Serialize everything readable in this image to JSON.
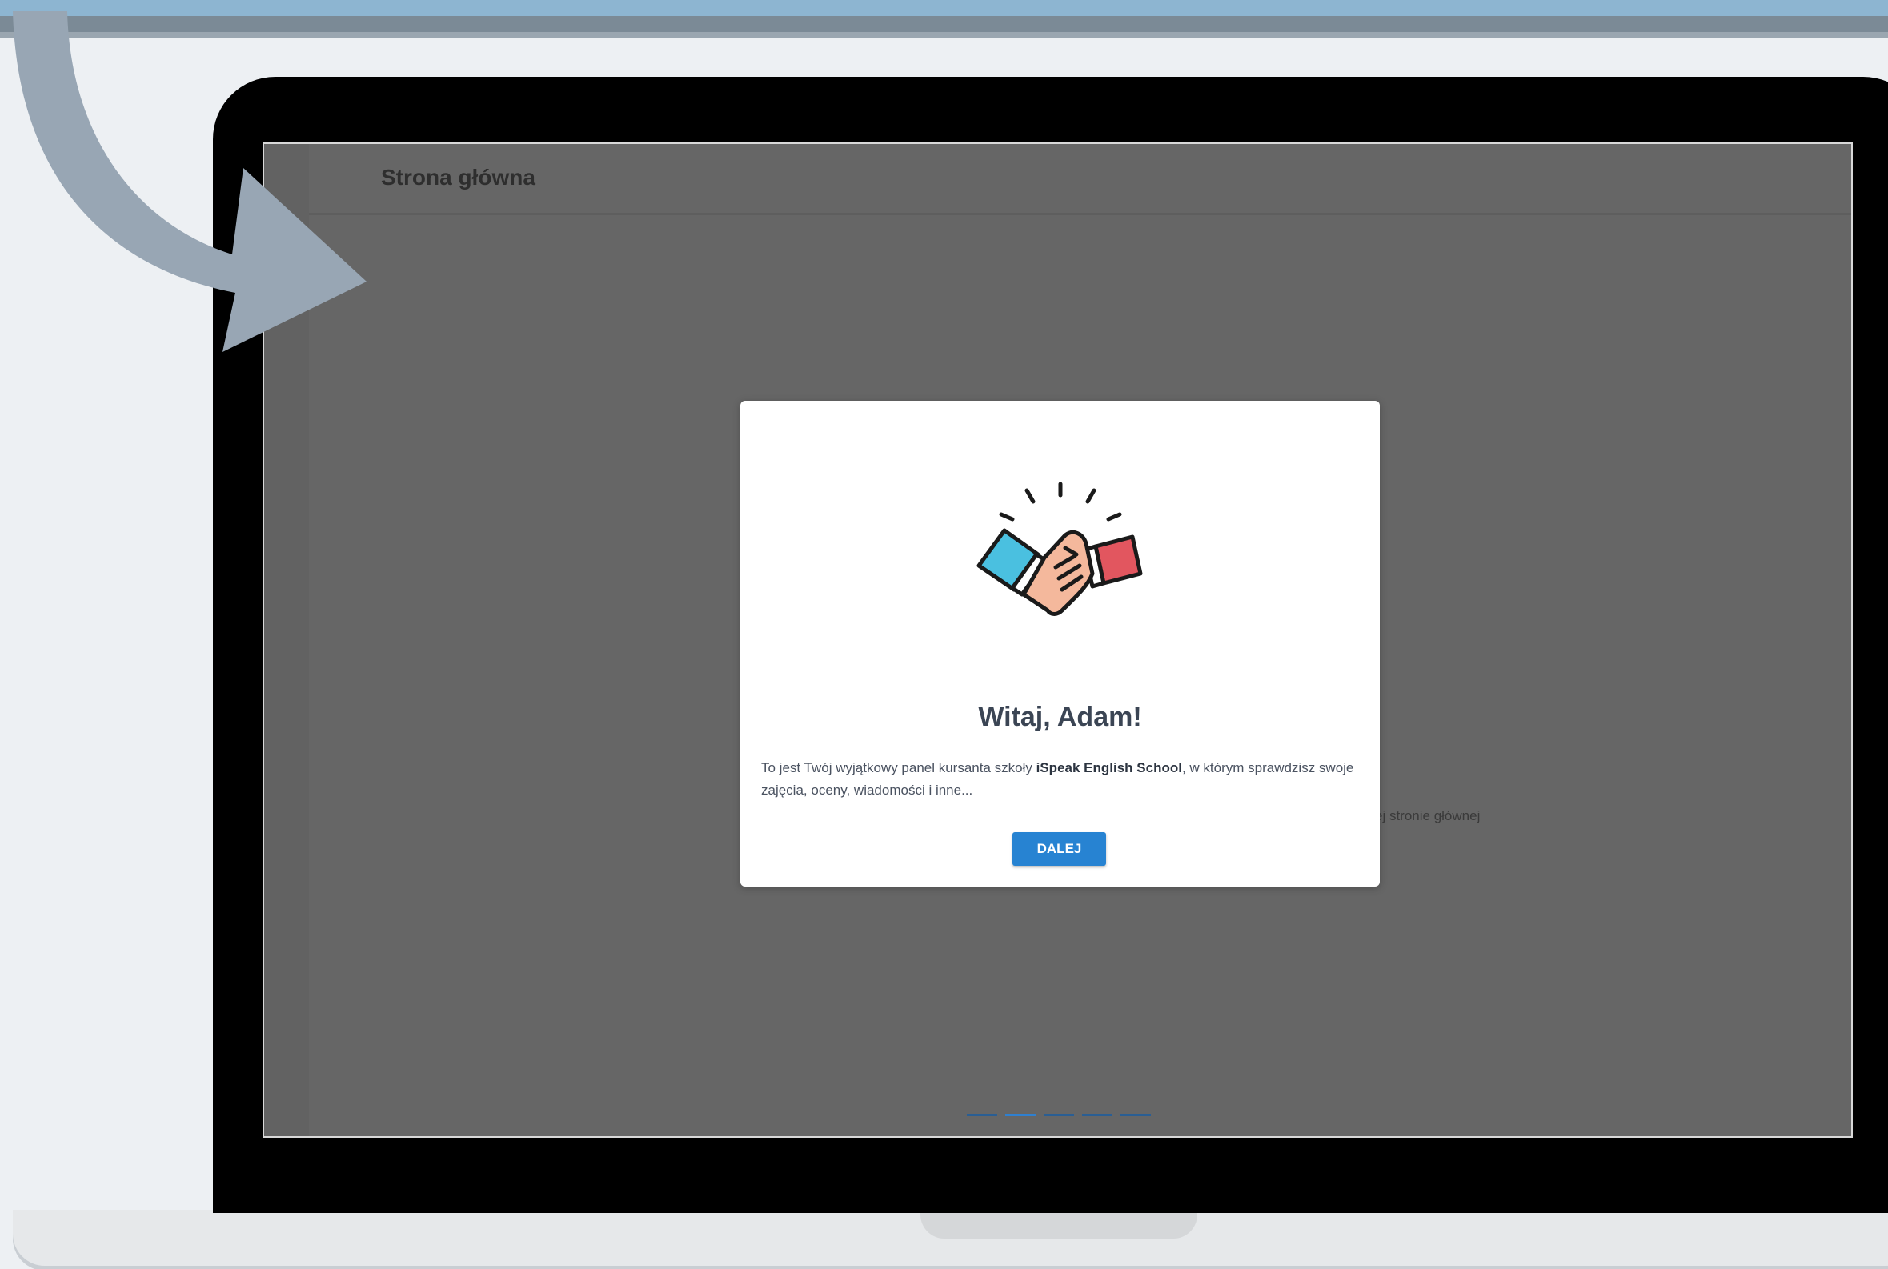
{
  "screen": {
    "page_title": "Strona główna",
    "background_text": "ej stronie głównej",
    "progress_steps": 5,
    "progress_active_index": 1
  },
  "modal": {
    "icon": "handshake-icon",
    "title": "Witaj, Adam!",
    "text_before": "To jest Twój wyjątkowy panel kursanta szkoły ",
    "text_bold": "iSpeak English School",
    "text_after": ", w którym sprawdzisz swoje zajęcia, oceny, wiadomości i inne...",
    "button_label": "DALEJ"
  },
  "colors": {
    "button": "#2783d2",
    "overlay": "#666666",
    "arrow": "#98a6b4",
    "cuff_left": "#4ac0e0",
    "cuff_right": "#e2565f",
    "skin": "#f4b89c"
  }
}
